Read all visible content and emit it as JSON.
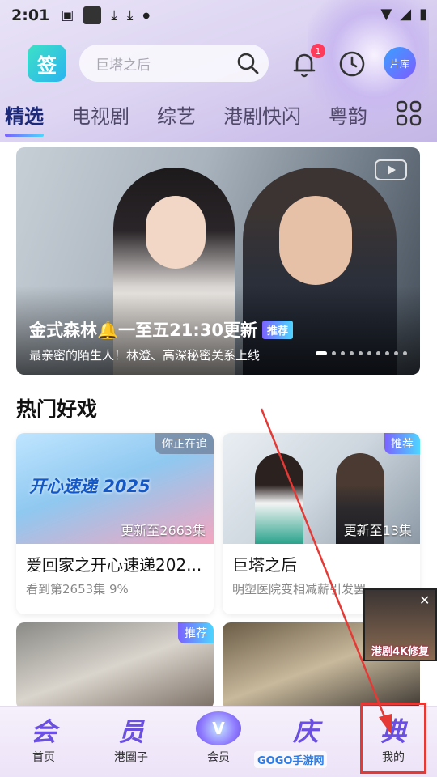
{
  "status": {
    "time": "2:01"
  },
  "header": {
    "logo_text": "签",
    "search_placeholder": "巨塔之后",
    "notification_count": "1",
    "library_label": "片库"
  },
  "tabs": [
    "精选",
    "电视剧",
    "综艺",
    "港剧快闪",
    "粤韵"
  ],
  "banner": {
    "title": "金式森林🔔一至五21:30更新",
    "tag": "推荐",
    "subtitle": "最亲密的陌生人！林澄、高深秘密关系上线"
  },
  "section": {
    "title": "热门好戏"
  },
  "cards": [
    {
      "tag": "你正在追",
      "episodes": "更新至2663集",
      "title": "爱回家之开心速递202...",
      "desc": "看到第2653集 9%",
      "poster_text": "开心速递 2025"
    },
    {
      "tag": "推荐",
      "episodes": "更新至13集",
      "title": "巨塔之后",
      "desc": "明塑医院变相减薪引发罢..."
    }
  ],
  "cards_row2": [
    {
      "tag": "推荐"
    },
    {
      "tag": ""
    }
  ],
  "float_ad": {
    "label": "港剧4K修复"
  },
  "nav": {
    "items": [
      {
        "glyph": "会",
        "label": "首页"
      },
      {
        "glyph": "员",
        "label": "港圈子"
      },
      {
        "glyph": "V",
        "label": "会员"
      },
      {
        "glyph": "庆",
        "label": ""
      },
      {
        "glyph": "典",
        "label": "我的"
      }
    ]
  },
  "watermark": "GOGO手游网",
  "colors": {
    "accent": "#6a4fe0",
    "active_tab": "#1d2a7a",
    "highlight": "#e53935"
  }
}
